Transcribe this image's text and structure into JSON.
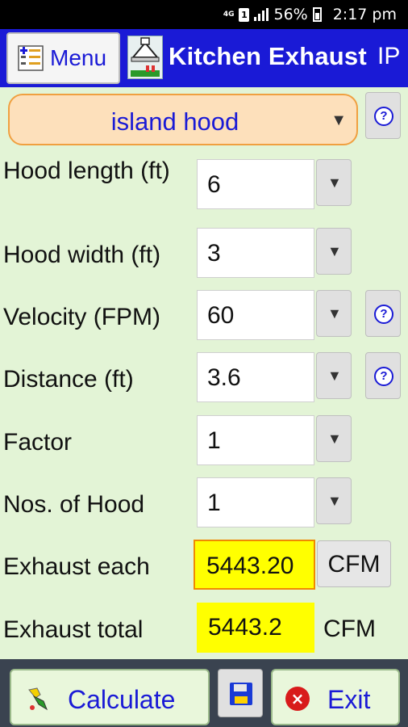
{
  "status_bar": {
    "network": "4G",
    "sim": "1",
    "battery": "56%",
    "time": "2:17 pm"
  },
  "header": {
    "menu_label": "Menu",
    "title": "Kitchen Exhaust",
    "unit_system": "IP"
  },
  "hood_type": {
    "selected": "island hood"
  },
  "fields": [
    {
      "label": "Hood length (ft)",
      "value": "6"
    },
    {
      "label": "Hood width (ft)",
      "value": "3"
    },
    {
      "label": "Velocity (FPM)",
      "value": "60"
    },
    {
      "label": "Distance (ft)",
      "value": "3.6"
    },
    {
      "label": "Factor",
      "value": "1"
    },
    {
      "label": "Nos. of Hood",
      "value": "1"
    }
  ],
  "results": {
    "each": {
      "label": "Exhaust each",
      "value": "5443.20",
      "unit": "CFM"
    },
    "total": {
      "label": "Exhaust total",
      "value": "5443.2",
      "unit": "CFM"
    }
  },
  "bottom": {
    "calculate_label": "Calculate",
    "exit_label": "Exit"
  },
  "colors": {
    "header_bg": "#1a1ad6",
    "page_bg": "#e3f4d6",
    "result_bg": "#ffff00",
    "accent_orange": "#f0a040"
  }
}
